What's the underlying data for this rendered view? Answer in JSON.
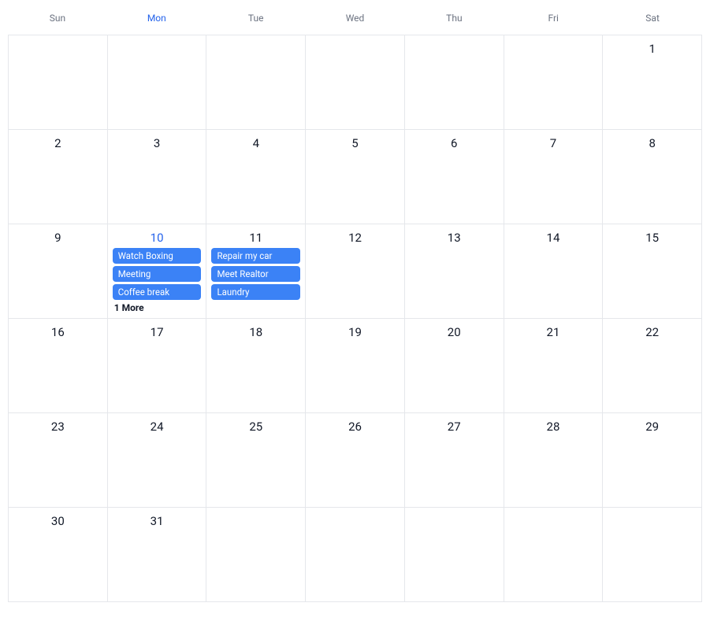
{
  "weekdays": [
    {
      "label": "Sun",
      "today": false
    },
    {
      "label": "Mon",
      "today": true
    },
    {
      "label": "Tue",
      "today": false
    },
    {
      "label": "Wed",
      "today": false
    },
    {
      "label": "Thu",
      "today": false
    },
    {
      "label": "Fri",
      "today": false
    },
    {
      "label": "Sat",
      "today": false
    }
  ],
  "weeks": [
    [
      {
        "day": ""
      },
      {
        "day": ""
      },
      {
        "day": ""
      },
      {
        "day": ""
      },
      {
        "day": ""
      },
      {
        "day": ""
      },
      {
        "day": "1"
      }
    ],
    [
      {
        "day": "2"
      },
      {
        "day": "3"
      },
      {
        "day": "4"
      },
      {
        "day": "5"
      },
      {
        "day": "6"
      },
      {
        "day": "7"
      },
      {
        "day": "8"
      }
    ],
    [
      {
        "day": "9"
      },
      {
        "day": "10",
        "today": true,
        "events": [
          "Watch Boxing",
          "Meeting",
          "Coffee break"
        ],
        "more": "1 More"
      },
      {
        "day": "11",
        "events": [
          "Repair my car",
          "Meet Realtor",
          "Laundry"
        ]
      },
      {
        "day": "12"
      },
      {
        "day": "13"
      },
      {
        "day": "14"
      },
      {
        "day": "15"
      }
    ],
    [
      {
        "day": "16"
      },
      {
        "day": "17"
      },
      {
        "day": "18"
      },
      {
        "day": "19"
      },
      {
        "day": "20"
      },
      {
        "day": "21"
      },
      {
        "day": "22"
      }
    ],
    [
      {
        "day": "23"
      },
      {
        "day": "24"
      },
      {
        "day": "25"
      },
      {
        "day": "26"
      },
      {
        "day": "27"
      },
      {
        "day": "28"
      },
      {
        "day": "29"
      }
    ],
    [
      {
        "day": "30"
      },
      {
        "day": "31"
      },
      {
        "day": ""
      },
      {
        "day": ""
      },
      {
        "day": ""
      },
      {
        "day": ""
      },
      {
        "day": ""
      }
    ]
  ]
}
